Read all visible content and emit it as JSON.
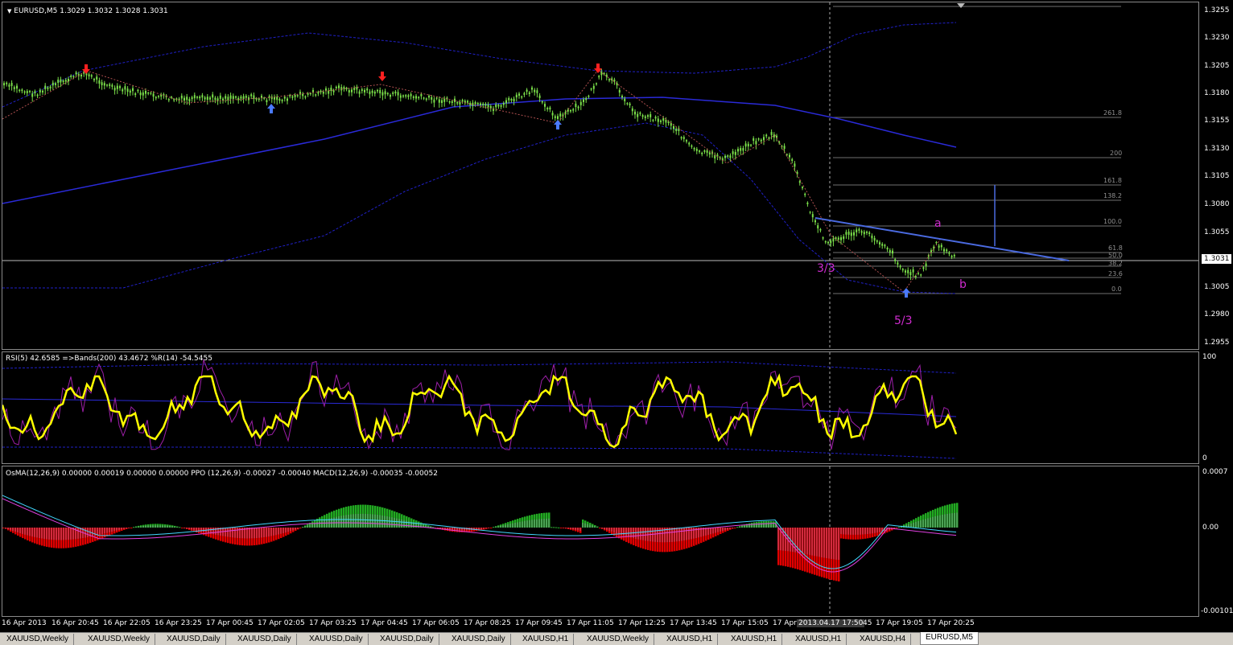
{
  "colors": {
    "background": "#000000",
    "candle": "#7be04a",
    "bands": "#2020c8",
    "ma": "#2a2ad8",
    "rsi": "#ffff00",
    "wpr": "#9d1fa8",
    "hist_pos": "#22aa22",
    "hist_neg": "#e00000",
    "macd_line": "#40d8ff",
    "signal_line": "#e040e0",
    "wave_label": "#d02bd0",
    "arrow_down": "#ff2020",
    "arrow_up": "#4a7aff",
    "trendline": "#4a6ae0"
  },
  "main_pane": {
    "title": "EURUSD,M5  1.3029 1.3032 1.3028 1.3031",
    "title_icon": "triangle-down-icon",
    "price_labels": [
      "1.3255",
      "1.3230",
      "1.3205",
      "1.3180",
      "1.3155",
      "1.3130",
      "1.3105",
      "1.3080",
      "1.3055",
      "1.3031",
      "1.3005",
      "1.2980",
      "1.2955"
    ],
    "current_price": "1.3031",
    "fib_levels": [
      "261.8",
      "200",
      "161.8",
      "138.2",
      "100.0",
      "61.8",
      "50.0",
      "38.2",
      "23.6",
      "0.0"
    ],
    "wave_labels": [
      "a",
      "3/3",
      "b",
      "5/3"
    ],
    "up_arrows": 3,
    "down_arrows": 3
  },
  "rsi_pane": {
    "title": "RSI(5) 42.6585  =>Bands(200) 43.4672  %R(14) -54.5455",
    "scale_top": "100",
    "scale_bottom": "0"
  },
  "macd_pane": {
    "title": "OsMA(12,26,9) 0.00000 0.00019 0.00000 0.00000  PPO (12,26,9) -0.00027 -0.00040  MACD(12,26,9) -0.00035 -0.00052",
    "scale_top": "0.0007",
    "scale_mid": "0.00",
    "scale_bottom": "-0.00101"
  },
  "time_axis": {
    "labels": [
      "16 Apr 2013",
      "16 Apr 20:45",
      "16 Apr 22:05",
      "16 Apr 23:25",
      "17 Apr 00:45",
      "17 Apr 02:05",
      "17 Apr 03:25",
      "17 Apr 04:45",
      "17 Apr 06:05",
      "17 Apr 08:25",
      "17 Apr 09:45",
      "17 Apr 11:05",
      "17 Apr 12:25",
      "17 Apr 13:45",
      "17 Apr 15:05",
      "17 Apr",
      "17 Apr 19:05",
      "17 Apr 20:25"
    ],
    "highlight": "2013.04.17 17:50",
    "highlight_suffix": "45"
  },
  "tabs": [
    "XAUUSD,Weekly",
    "XAUUSD,Weekly",
    "XAUUSD,Daily",
    "XAUUSD,Daily",
    "XAUUSD,Daily",
    "XAUUSD,Daily",
    "XAUUSD,Daily",
    "XAUUSD,H1",
    "XAUUSD,Weekly",
    "XAUUSD,H1",
    "XAUUSD,H1",
    "XAUUSD,H1",
    "XAUUSD,H4",
    "EURUSD,M5"
  ],
  "active_tab": "EURUSD,M5"
}
